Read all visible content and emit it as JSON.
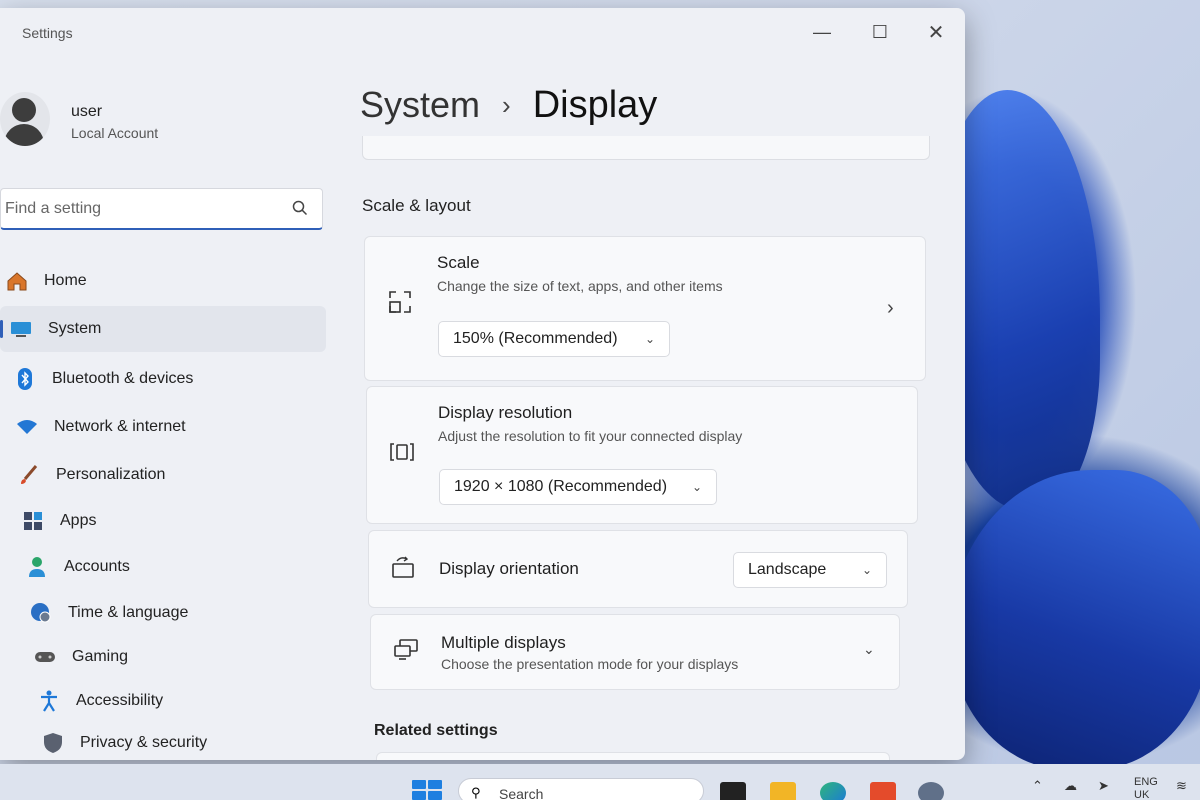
{
  "window": {
    "app_title": "Settings",
    "controls": {
      "minimize": "—",
      "maximize": "☐",
      "close": "✕"
    }
  },
  "profile": {
    "name": "user",
    "account_type": "Local Account"
  },
  "search": {
    "placeholder": "Find a setting"
  },
  "nav": {
    "items": [
      {
        "label": "Home",
        "icon": "home-icon",
        "active": false
      },
      {
        "label": "System",
        "icon": "system-icon",
        "active": true
      },
      {
        "label": "Bluetooth & devices",
        "icon": "bluetooth-icon",
        "active": false
      },
      {
        "label": "Network & internet",
        "icon": "wifi-icon",
        "active": false
      },
      {
        "label": "Personalization",
        "icon": "brush-icon",
        "active": false
      },
      {
        "label": "Apps",
        "icon": "apps-icon",
        "active": false
      },
      {
        "label": "Accounts",
        "icon": "accounts-icon",
        "active": false
      },
      {
        "label": "Time & language",
        "icon": "globe-clock-icon",
        "active": false
      },
      {
        "label": "Gaming",
        "icon": "gamepad-icon",
        "active": false
      },
      {
        "label": "Accessibility",
        "icon": "accessibility-icon",
        "active": false
      },
      {
        "label": "Privacy & security",
        "icon": "shield-icon",
        "active": false
      }
    ]
  },
  "breadcrumb": {
    "parent": "System",
    "separator": "›",
    "current": "Display"
  },
  "sections": {
    "scale_layout": "Scale & layout",
    "related": "Related settings"
  },
  "scale": {
    "title": "Scale",
    "subtitle": "Change the size of text, apps, and other items",
    "value": "150% (Recommended)"
  },
  "resolution": {
    "title": "Display resolution",
    "subtitle": "Adjust the resolution to fit your connected display",
    "value": "1920 × 1080 (Recommended)"
  },
  "orientation": {
    "title": "Display orientation",
    "value": "Landscape"
  },
  "multiple_displays": {
    "title": "Multiple displays",
    "subtitle": "Choose the presentation mode for your displays"
  },
  "taskbar": {
    "search_label": "Search",
    "language": "ENG",
    "region": "UK"
  },
  "colors": {
    "accent": "#2f5fb8",
    "window_bg": "#eef0f5",
    "card_bg": "#f8f9fb",
    "wallpaper_blue": "#1d46b8"
  }
}
